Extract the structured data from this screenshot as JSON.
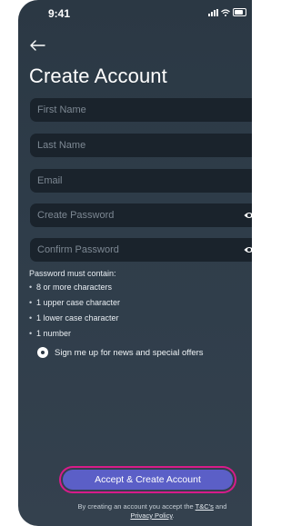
{
  "status_bar": {
    "time": "9:41",
    "icons": [
      "signal-icon",
      "wifi-icon",
      "battery-icon"
    ]
  },
  "header": {
    "back_icon": "arrow-left-icon",
    "title": "Create Account"
  },
  "form": {
    "first_name": {
      "placeholder": "First Name",
      "value": ""
    },
    "last_name": {
      "placeholder": "Last Name",
      "value": ""
    },
    "email": {
      "placeholder": "Email",
      "value": ""
    },
    "create_password": {
      "placeholder": "Create Password",
      "value": "",
      "icon": "eye-icon"
    },
    "confirm_password": {
      "placeholder": "Confirm Password",
      "value": "",
      "icon": "eye-icon"
    }
  },
  "password_rules": {
    "heading": "Password must contain:",
    "items": [
      "8 or more characters",
      "1 upper case character",
      "1 lower case character",
      "1 number"
    ]
  },
  "optin": {
    "label": "Sign me up for news and special offers",
    "selected": true
  },
  "cta": {
    "label": "Accept & Create Account"
  },
  "legal": {
    "prefix": "By creating an account you accept the ",
    "tc_link": "T&C's",
    "middle": " and",
    "privacy_link": "Privacy Policy",
    "suffix": "."
  },
  "colors": {
    "background": "#2f3d4a",
    "field": "#1a232c",
    "button": "#5b5fc7",
    "button_border": "#d81b8a"
  }
}
